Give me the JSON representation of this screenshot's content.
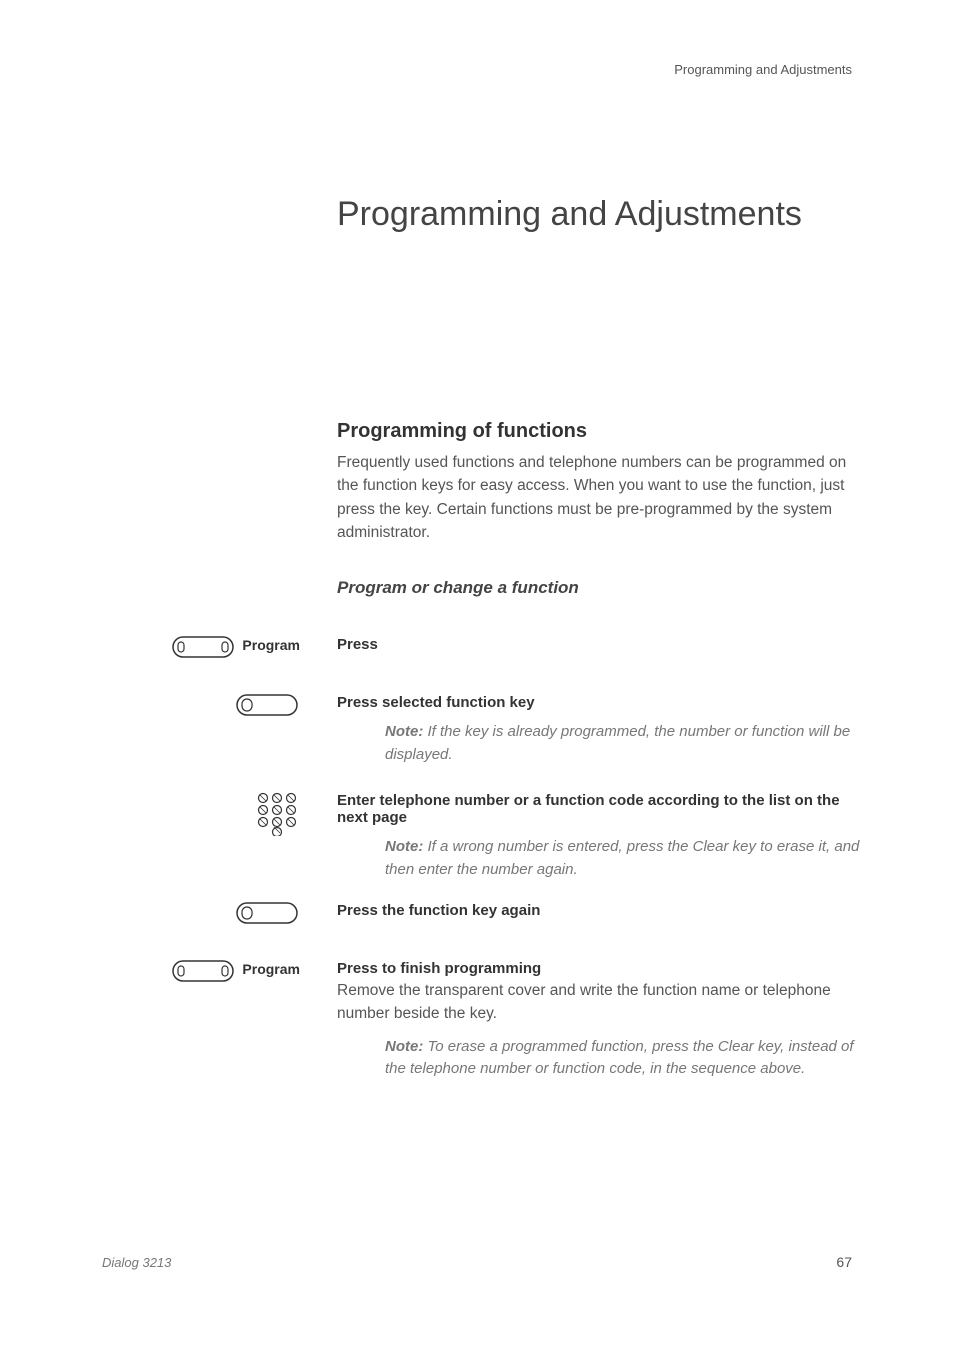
{
  "header": {
    "section": "Programming and Adjustments"
  },
  "title": "Programming and Adjustments",
  "section1": {
    "heading": "Programming of functions",
    "body": "Frequently used functions and telephone numbers can be programmed on the function keys for easy access. When you want to use the function, just press the key. Certain functions must be pre-programmed by the system administrator."
  },
  "section2": {
    "heading": "Program or change a function"
  },
  "steps": {
    "step1": {
      "label": "Program",
      "instruction": "Press"
    },
    "step2": {
      "instruction": "Press selected function key",
      "note_label": "Note:",
      "note": " If the key is already programmed, the number or function will be displayed."
    },
    "step3": {
      "instruction": "Enter telephone number or a function code according to the list on the next page",
      "note_label": "Note:",
      "note": " If a wrong number is entered, press the Clear key to erase it, and then enter the number again."
    },
    "step4": {
      "instruction": "Press the function key again"
    },
    "step5": {
      "label": "Program",
      "instruction": "Press to finish programming",
      "desc": "Remove the transparent cover and write the function name or telephone number beside the key.",
      "note_label": "Note:",
      "note": " To erase a programmed function, press the Clear key, instead of the telephone number or function code, in the sequence above."
    }
  },
  "footer": {
    "left": "Dialog 3213",
    "right": "67"
  }
}
